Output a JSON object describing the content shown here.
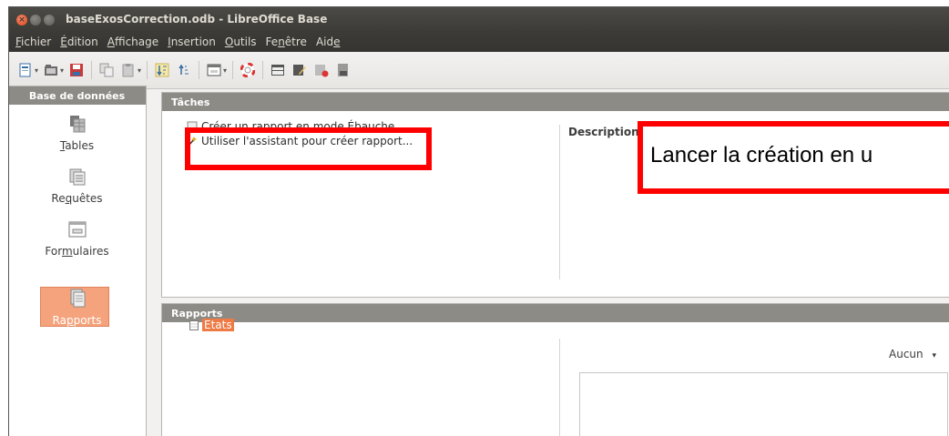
{
  "window": {
    "title": "baseExosCorrection.odb - LibreOffice Base",
    "buttons": [
      "close-icon",
      "minimize-icon",
      "maximize-icon"
    ]
  },
  "menu": [
    {
      "pre": "",
      "u": "F",
      "post": "ichier"
    },
    {
      "pre": "",
      "u": "É",
      "post": "dition"
    },
    {
      "pre": "",
      "u": "A",
      "post": "ffichage"
    },
    {
      "pre": "",
      "u": "I",
      "post": "nsertion"
    },
    {
      "pre": "",
      "u": "O",
      "post": "utils"
    },
    {
      "pre": "Fe",
      "u": "n",
      "post": "être"
    },
    {
      "pre": "Aid",
      "u": "e",
      "post": ""
    }
  ],
  "sidebar": {
    "header": "Base de données",
    "items": [
      {
        "pre": "",
        "u": "T",
        "post": "ables",
        "icon": "tables-icon"
      },
      {
        "pre": "Re",
        "u": "q",
        "post": "uêtes",
        "icon": "queries-icon"
      },
      {
        "pre": "For",
        "u": "m",
        "post": "ulaires",
        "icon": "forms-icon"
      },
      {
        "pre": "Ra",
        "u": "p",
        "post": "ports",
        "icon": "reports-icon",
        "active": true
      }
    ]
  },
  "tasks": {
    "header": "Tâches",
    "items": [
      {
        "label": "Créer un rapport en mode Ébauche...",
        "icon": "report-design-icon"
      },
      {
        "label": "Utiliser l'assistant pour créer rapport...",
        "icon": "wizard-icon"
      }
    ],
    "description_label": "Description"
  },
  "reports": {
    "header": "Rapports",
    "folder": "Etats",
    "preview_mode": "Aucun"
  },
  "annotation": {
    "text": "Lancer la création en u"
  },
  "colors": {
    "title_bar": "#3c3b37",
    "panel_header": "#8d8b86",
    "selection": "#ee7a45",
    "annotation_border": "#ff0000"
  }
}
